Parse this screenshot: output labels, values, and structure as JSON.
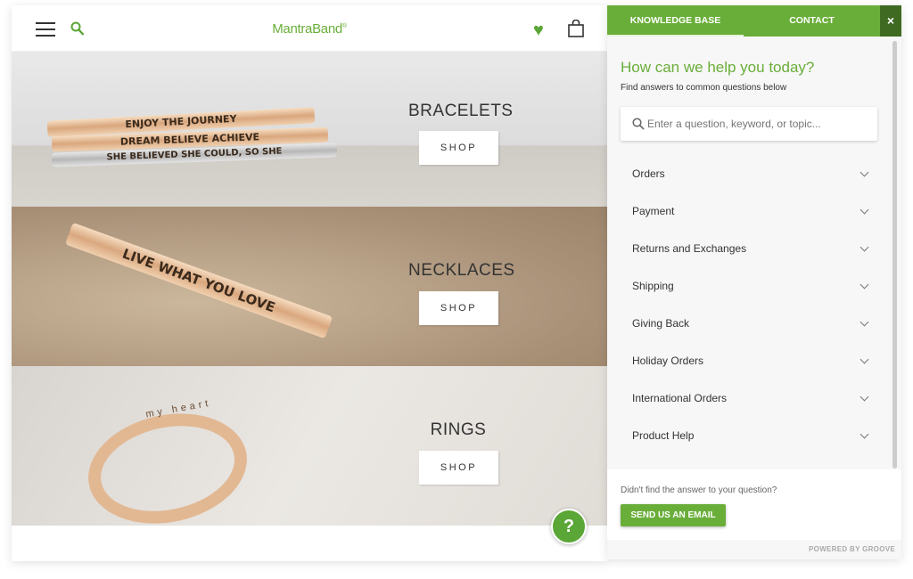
{
  "header": {
    "logo": "MantraBand",
    "logo_mark": "®",
    "menu_icon": "hamburger-icon",
    "search_icon": "search-icon",
    "wishlist_icon": "heart-icon",
    "cart_icon": "shopping-bag-icon"
  },
  "categories": [
    {
      "name": "BRACELETS",
      "shop": "SHOP",
      "engravings": [
        "ENJOY THE JOURNEY",
        "DREAM BELIEVE ACHIEVE",
        "SHE BELIEVED SHE COULD, SO SHE"
      ]
    },
    {
      "name": "NECKLACES",
      "shop": "SHOP",
      "engravings": [
        "LIVE WHAT YOU LOVE"
      ]
    },
    {
      "name": "RINGS",
      "shop": "SHOP",
      "engravings": [
        "my heart"
      ]
    }
  ],
  "help_button": "?",
  "widget": {
    "tabs": [
      {
        "label": "KNOWLEDGE BASE",
        "active": true
      },
      {
        "label": "CONTACT",
        "active": false
      }
    ],
    "close": "×",
    "title": "How can we help you today?",
    "subtitle": "Find answers to common questions below",
    "search_placeholder": "Enter a question, keyword, or topic...",
    "items": [
      "Orders",
      "Payment",
      "Returns and Exchanges",
      "Shipping",
      "Giving Back",
      "Holiday Orders",
      "International Orders",
      "Product Help"
    ],
    "footer_question": "Didn't find the answer to your question?",
    "email_button": "SEND US AN EMAIL",
    "powered": "POWERED BY GROOVE",
    "accent": "#6aae3a"
  }
}
